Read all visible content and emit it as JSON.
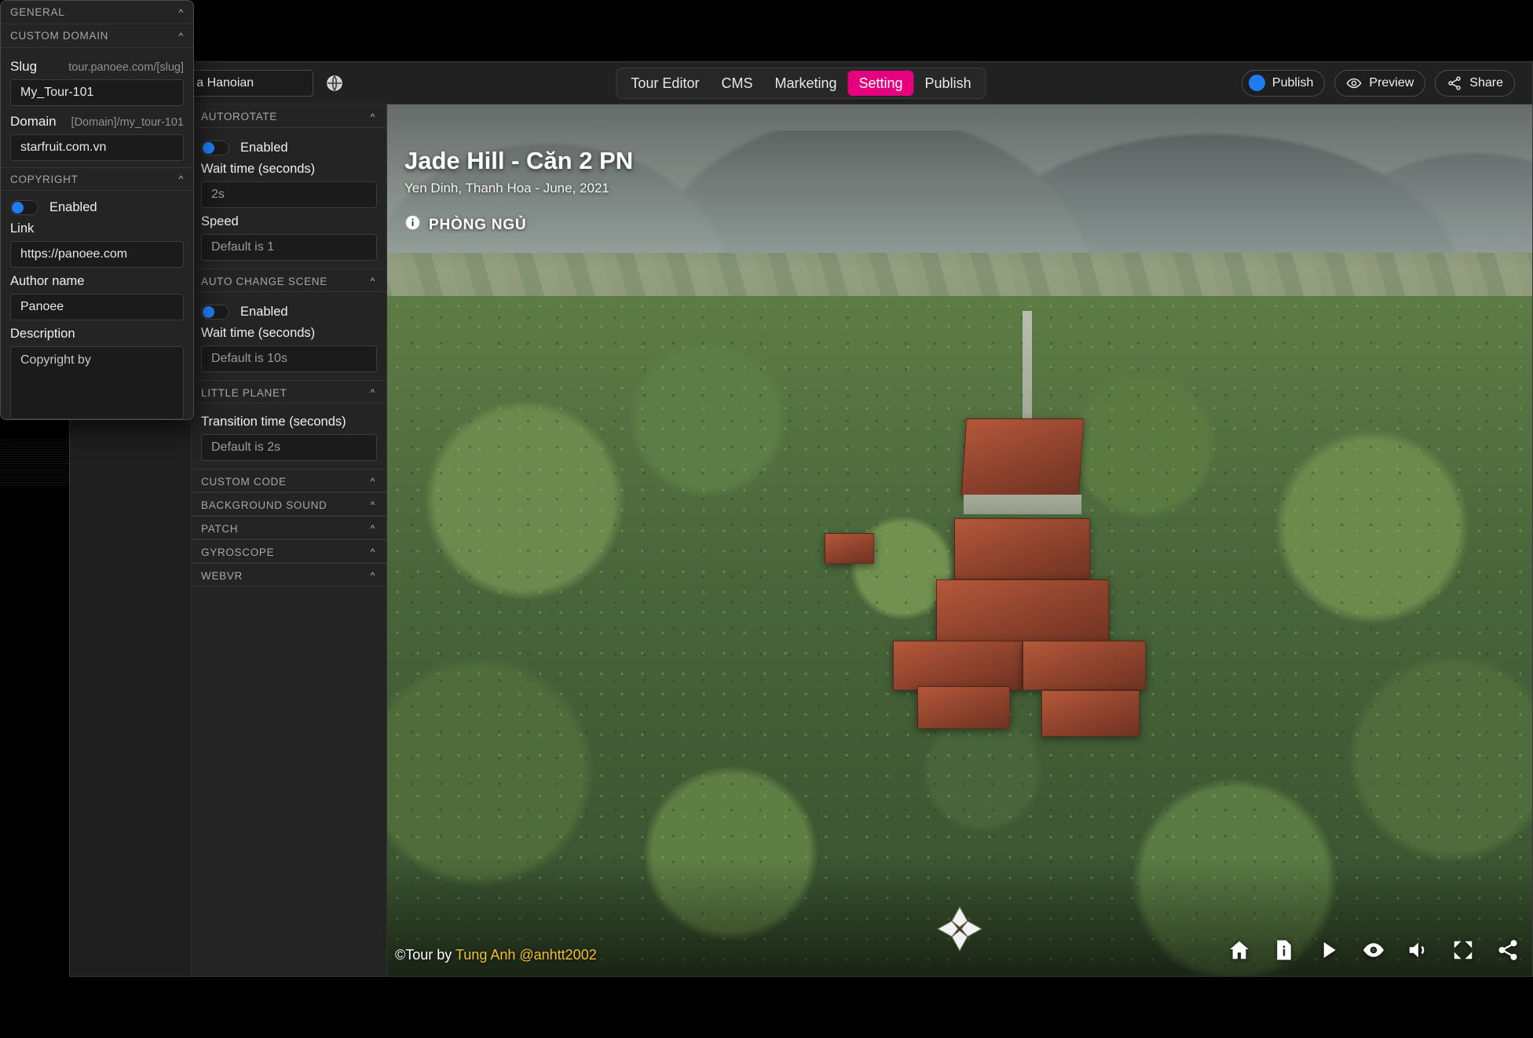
{
  "topbar": {
    "tour_name_value": "y of a Hanoian",
    "globe_icon": "globe-icon",
    "nav_items": [
      {
        "label": "Tour Editor",
        "active": false
      },
      {
        "label": "CMS",
        "active": false
      },
      {
        "label": "Marketing",
        "active": false
      },
      {
        "label": "Setting",
        "active": true
      },
      {
        "label": "Publish",
        "active": false
      }
    ],
    "publish_label": "Publish",
    "preview_label": "Preview",
    "share_label": "Share",
    "accent_color": "#e5007d",
    "publish_dot_color": "#1f7bf0"
  },
  "settings_panel": {
    "sections": [
      {
        "id": "autorotate",
        "title": "AUTOROTATE",
        "collapsed": false,
        "toggle_label": "Enabled",
        "toggle_on": true,
        "fields": [
          {
            "label": "Wait time (seconds)",
            "placeholder": "2s",
            "value": ""
          },
          {
            "label": "Speed",
            "placeholder": "Default is 1",
            "value": ""
          }
        ]
      },
      {
        "id": "auto-change-scene",
        "title": "AUTO CHANGE SCENE",
        "collapsed": false,
        "toggle_label": "Enabled",
        "toggle_on": true,
        "fields": [
          {
            "label": "Wait time (seconds)",
            "placeholder": "Default is 10s",
            "value": ""
          }
        ]
      },
      {
        "id": "little-planet",
        "title": "LITTLE PLANET",
        "collapsed": false,
        "fields": [
          {
            "label": "Transition time (seconds)",
            "placeholder": "Default is 2s",
            "value": ""
          }
        ]
      },
      {
        "id": "custom-code",
        "title": "CUSTOM CODE",
        "collapsed": true
      },
      {
        "id": "background-sound",
        "title": "BACKGROUND SOUND",
        "collapsed": true
      },
      {
        "id": "patch",
        "title": "PATCH",
        "collapsed": true
      },
      {
        "id": "gyroscope",
        "title": "GYROSCOPE",
        "collapsed": true
      },
      {
        "id": "webvr",
        "title": "WEBVR",
        "collapsed": true
      }
    ]
  },
  "overlay_panel": {
    "general_title": "GENERAL",
    "custom_domain": {
      "title": "CUSTOM DOMAIN",
      "slug_label": "Slug",
      "slug_hint": "tour.panoee.com/[slug]",
      "slug_value": "My_Tour-101",
      "domain_label": "Domain",
      "domain_hint": "[Domain]/my_tour-101",
      "domain_value": "starfruit.com.vn"
    },
    "copyright": {
      "title": "COPYRIGHT",
      "toggle_label": "Enabled",
      "toggle_on": true,
      "link_label": "Link",
      "link_value": "https://panoee.com",
      "author_label": "Author name",
      "author_value": "Panoee",
      "description_label": "Description",
      "description_placeholder": "Copyright by"
    }
  },
  "viewer": {
    "scene_title": "Jade Hill - Căn 2 PN",
    "scene_subtitle": "Yen Dinh, Thanh Hoa - June, 2021",
    "hotspot_label": "PHÒNG NGỦ",
    "hotspot_icon": "info-circle-icon",
    "credit_prefix": "©Tour by ",
    "credit_author": "Tung Anh @anhtt2002",
    "credit_author_color": "#f2c029",
    "compass_icon": "four-way-nav-icon",
    "tools": [
      {
        "name": "home-icon",
        "label": "Home"
      },
      {
        "name": "info-document-icon",
        "label": "Information"
      },
      {
        "name": "play-icon",
        "label": "Play"
      },
      {
        "name": "eye-icon",
        "label": "Visibility"
      },
      {
        "name": "volume-icon",
        "label": "Sound"
      },
      {
        "name": "fullscreen-icon",
        "label": "Fullscreen"
      },
      {
        "name": "share-icon",
        "label": "Share"
      }
    ]
  }
}
